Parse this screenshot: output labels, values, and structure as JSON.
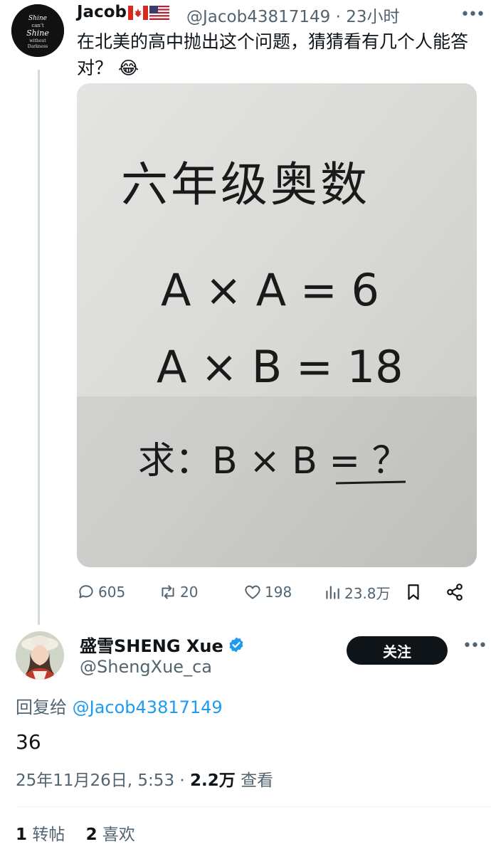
{
  "tweet": {
    "author_name": "Jacob",
    "flags": [
      "canada-flag",
      "usa-flag"
    ],
    "handle": "@Jacob43817149",
    "separator": "·",
    "time": "23小时",
    "text": "在北美的高中抛出这个问题，猜猜看有几个人能答对？",
    "emoji": "😂",
    "media": {
      "line1": "六年级奥数",
      "line2": "A × A = 6",
      "line3": "A × B = 18",
      "line4": "求：B × B = ？"
    },
    "actions": {
      "replies": "605",
      "retweets": "20",
      "likes": "198",
      "views": "23.8万"
    }
  },
  "reply": {
    "author_name": "盛雪SHENG Xue",
    "verified": true,
    "handle": "@ShengXue_ca",
    "follow_label": "关注",
    "reply_to_label": "回复给",
    "reply_to_handle": "@Jacob43817149",
    "text": "36",
    "date": "25年11月26日, 5:53",
    "separator": "·",
    "views_count": "2.2万",
    "views_label": "查看",
    "retweet_count": "1",
    "retweet_label": "转帖",
    "like_count": "2",
    "like_label": "喜欢"
  },
  "colors": {
    "text": "#0f1419",
    "secondary": "#536471",
    "link": "#1d9bf0",
    "follow_bg": "#0f1419"
  }
}
